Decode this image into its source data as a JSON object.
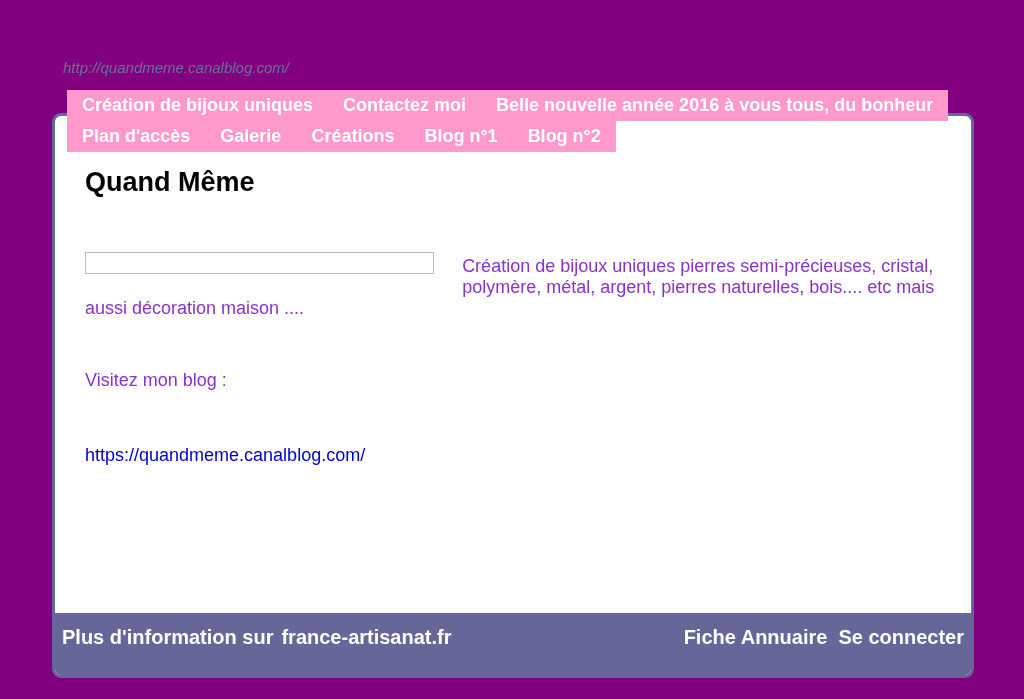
{
  "site_url": "http://quandmeme.canalblog.com/",
  "menu": {
    "items": [
      "Création de bijoux uniques",
      "Contactez moi",
      "Belle nouvelle année 2016 à vous tous, du bonheur",
      "Plan d'accès",
      "Galerie",
      "Créations",
      "Blog n°1",
      "Blog n°2"
    ]
  },
  "title": "Quand Même",
  "intro_right": "Création de bijoux uniques pierres semi-précieuses, cristal, polymère, métal, argent, pierres naturelles, bois.... etc mais",
  "intro_left": "aussi décoration maison ....",
  "blog_label": "Visitez mon blog :",
  "blog_link": "https://quandmeme.canalblog.com/",
  "footer": {
    "info_label": "Plus d'information sur",
    "info_link": "france-artisanat.fr",
    "links": [
      "Fiche Annuaire",
      "Se connecter"
    ]
  }
}
